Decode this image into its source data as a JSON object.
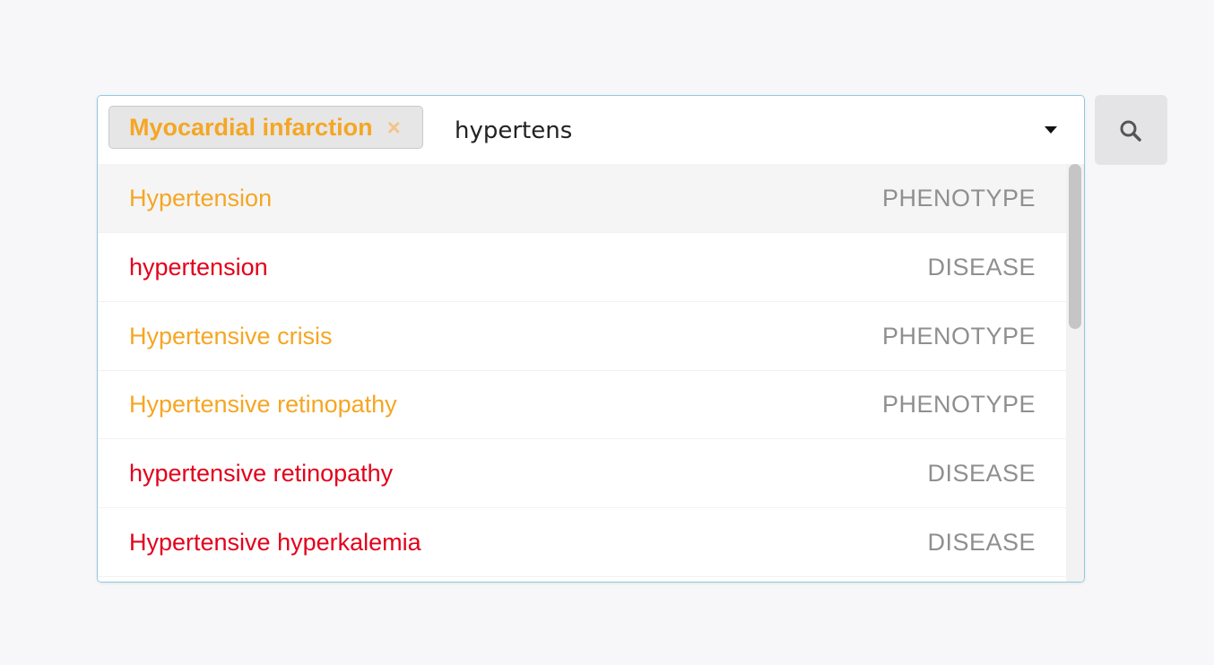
{
  "selected_chip": {
    "label": "Myocardial infarction",
    "remove_icon": "×"
  },
  "query": "hypertens",
  "icons": {
    "dropdown": "caret-down-icon",
    "search": "search-icon",
    "remove": "close-icon"
  },
  "colors": {
    "phenotype": "#f5a623",
    "disease": "#e3001b",
    "type_label": "#8f8f8f",
    "focus_border": "#8fc9df"
  },
  "options": [
    {
      "label": "Hypertension",
      "type": "PHENOTYPE",
      "focused": true
    },
    {
      "label": "hypertension",
      "type": "DISEASE"
    },
    {
      "label": "Hypertensive crisis",
      "type": "PHENOTYPE"
    },
    {
      "label": "Hypertensive retinopathy",
      "type": "PHENOTYPE"
    },
    {
      "label": "hypertensive retinopathy",
      "type": "DISEASE"
    },
    {
      "label": "Hypertensive hyperkalemia",
      "type": "DISEASE"
    }
  ]
}
